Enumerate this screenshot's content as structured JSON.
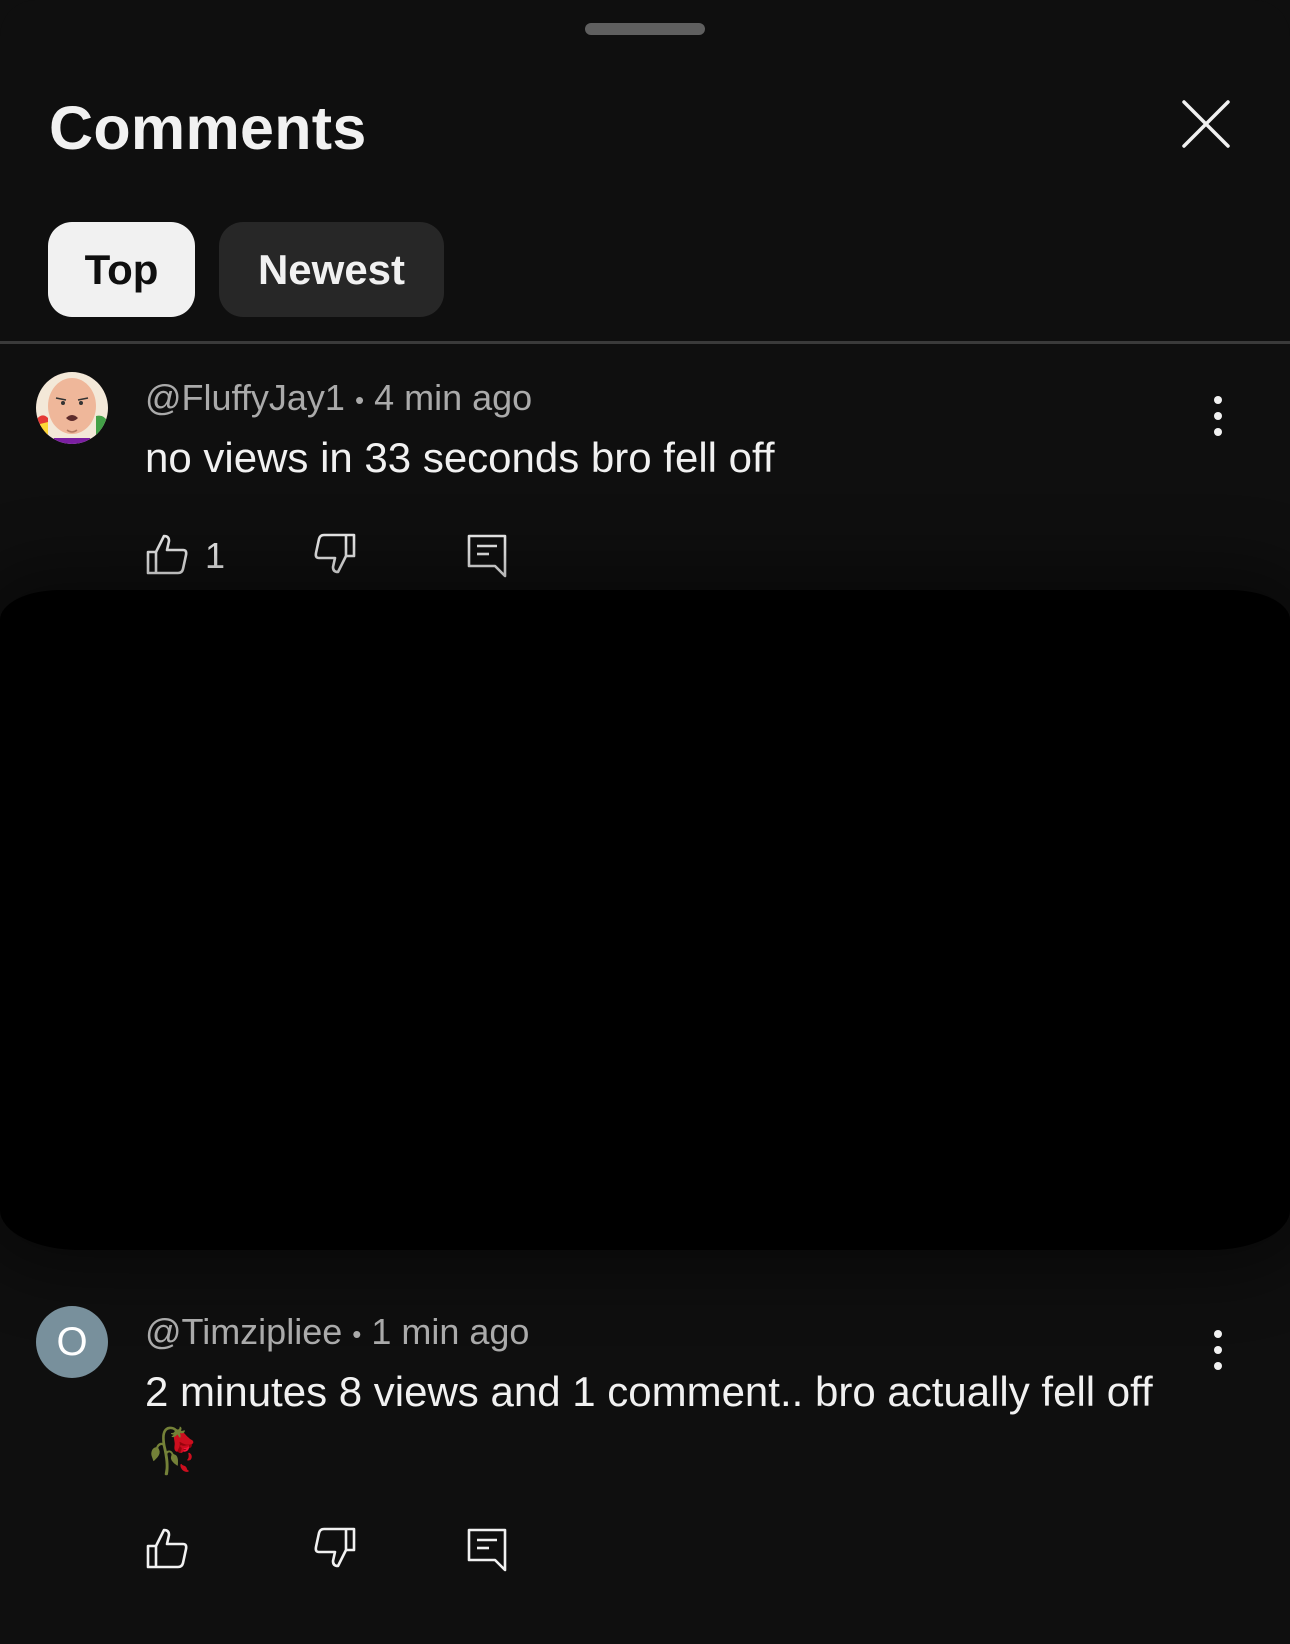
{
  "sheet": {
    "title": "Comments",
    "tabs": [
      {
        "label": "Top",
        "selected": true
      },
      {
        "label": "Newest",
        "selected": false
      }
    ]
  },
  "comments": [
    {
      "handle": "@FluffyJay1",
      "separator": "•",
      "time": "4 min ago",
      "text": "no views in 33 seconds bro fell off",
      "likes": "1",
      "avatar_icon": "cartoon-face-avatar"
    },
    {
      "handle": "@Timzipliee",
      "separator": "•",
      "time": "1 min ago",
      "text": "2 minutes 8 views and 1 comment.. bro actually fell off",
      "emoji": "🥀",
      "avatar_letter": "O",
      "avatar_color": "#78909c"
    }
  ],
  "colors": {
    "background": "#0f0f0f",
    "chip_selected": "#f1f1f1",
    "chip_unselected": "#272727",
    "secondary_text": "#aaaaaa"
  }
}
